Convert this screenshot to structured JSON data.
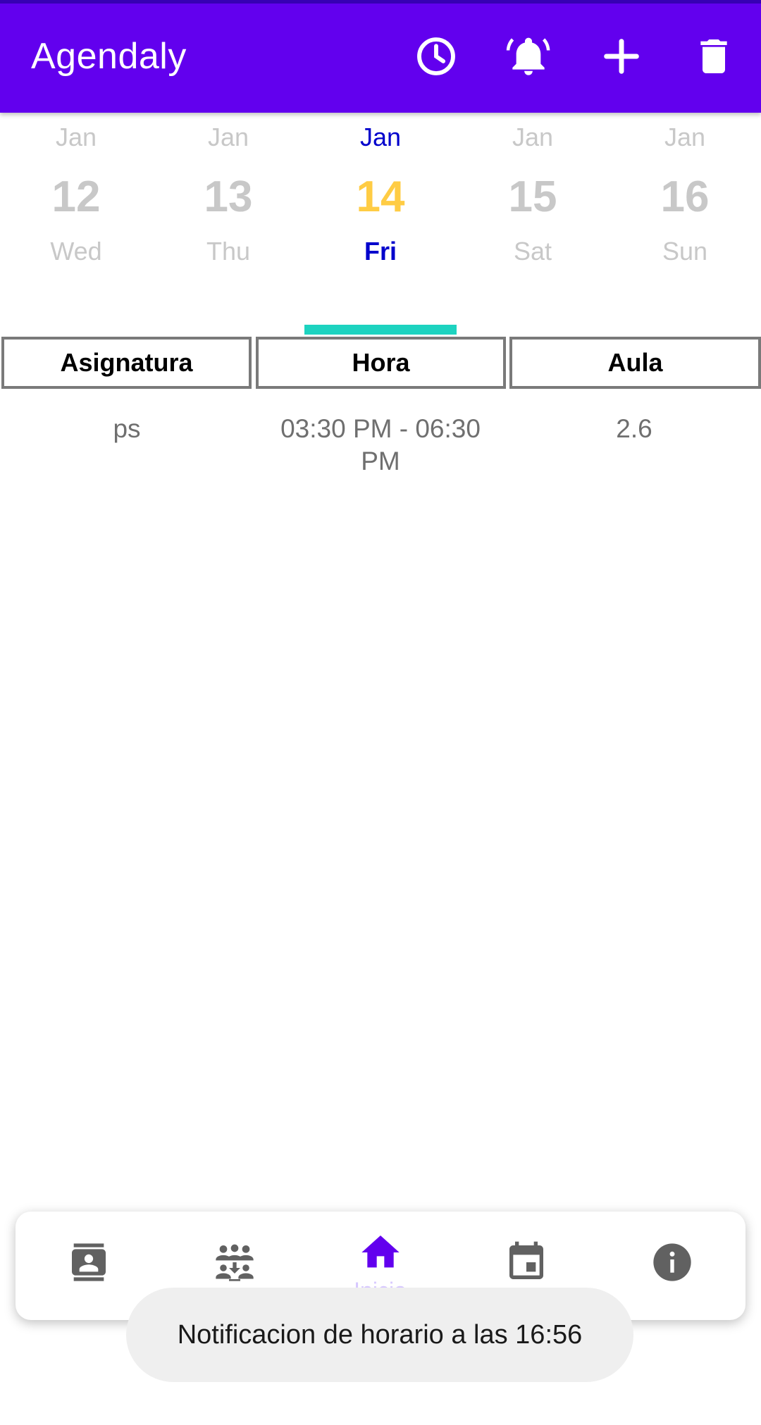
{
  "app_bar": {
    "title": "Agendaly",
    "background_color": "#6200EE",
    "actions": [
      {
        "name": "clock-icon"
      },
      {
        "name": "bell-ring-icon"
      },
      {
        "name": "add-icon"
      },
      {
        "name": "trash-icon"
      }
    ]
  },
  "date_strip": {
    "days": [
      {
        "month": "Jan",
        "day": "12",
        "weekday": "Wed",
        "selected": false
      },
      {
        "month": "Jan",
        "day": "13",
        "weekday": "Thu",
        "selected": false
      },
      {
        "month": "Jan",
        "day": "14",
        "weekday": "Fri",
        "selected": true
      },
      {
        "month": "Jan",
        "day": "15",
        "weekday": "Sat",
        "selected": false
      },
      {
        "month": "Jan",
        "day": "16",
        "weekday": "Sun",
        "selected": false
      }
    ],
    "selected_color": "#0000CC",
    "selected_number_color": "#FFCC44",
    "indicator_color": "#1DD3C0"
  },
  "table": {
    "headers": [
      "Asignatura",
      "Hora",
      "Aula"
    ],
    "rows": [
      [
        "ps",
        "03:30 PM - 06:30 PM",
        "2.6"
      ]
    ]
  },
  "bottom_nav": {
    "items": [
      {
        "name": "contacts-icon",
        "label": ""
      },
      {
        "name": "group-icon",
        "label": ""
      },
      {
        "name": "home-icon",
        "label": "Inicio",
        "active": true
      },
      {
        "name": "calendar-icon",
        "label": ""
      },
      {
        "name": "info-icon",
        "label": ""
      }
    ],
    "active_color": "#6200EE"
  },
  "toast": {
    "text": "Notificacion de horario a las 16:56"
  }
}
